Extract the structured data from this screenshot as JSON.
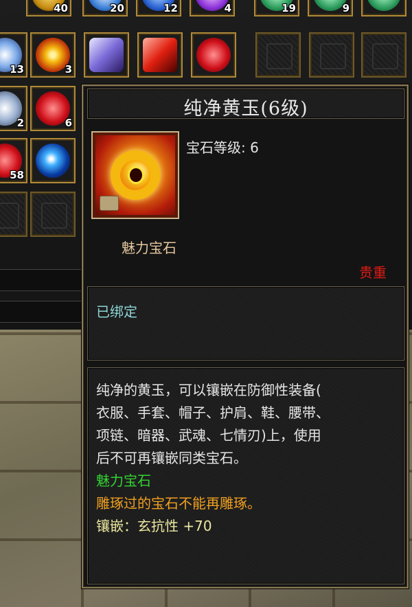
{
  "inventory": {
    "top_row_counts": [
      "40",
      "20",
      "12",
      "4",
      "19",
      "9"
    ],
    "row2_counts": [
      "13",
      "3"
    ],
    "row3_counts": [
      "2",
      "6"
    ],
    "row4_counts": [
      "58"
    ]
  },
  "tooltip": {
    "title": "纯净黄玉(6级)",
    "level_label": "宝石等级: 6",
    "gem_type": "魅力宝石",
    "rarity": "贵重",
    "bound_status": "已绑定",
    "description_lines": [
      "纯净的黄玉，可以镶嵌在防御性装备(",
      "衣服、手套、帽子、护肩、鞋、腰带、",
      "项链、暗器、武魂、七情刃)上，使用",
      "后不可再镶嵌同类宝石。"
    ],
    "gem_type_line": "魅力宝石",
    "carve_note": "雕琢过的宝石不能再雕琢。",
    "inlay_bonus": "镶嵌：玄抗性 +70"
  },
  "colors": {
    "rarity": "#e01a14",
    "bound": "#8fd6d6",
    "gem_type_line": "#33d433",
    "carve_note": "#f0a020",
    "inlay_bonus": "#ece8a0",
    "gem_type": "#e6c9a0"
  },
  "icons": [
    "yellow-jade-icon",
    "lock-icon",
    "ruby-gem-icon",
    "diamond-gem-icon",
    "sapphire-orb-icon",
    "jade-gem-icon"
  ]
}
